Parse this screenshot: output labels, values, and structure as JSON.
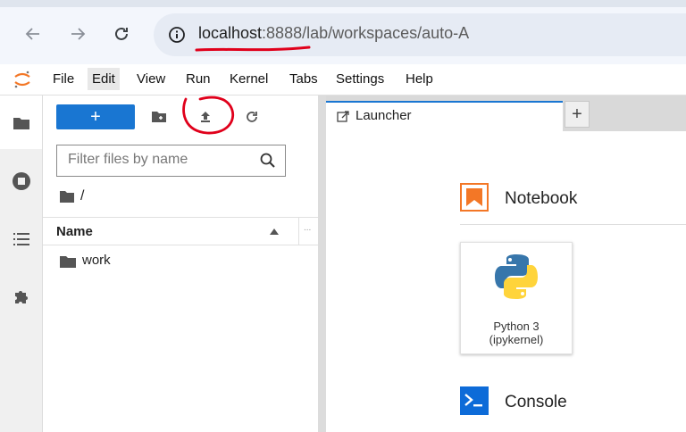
{
  "browser": {
    "url_host": "localhost",
    "url_rest": ":8888/lab/workspaces/auto-A"
  },
  "menubar": {
    "items": [
      "File",
      "Edit",
      "View",
      "Run",
      "Kernel",
      "Tabs",
      "Settings",
      "Help"
    ],
    "active_item": "Edit"
  },
  "filebrowser": {
    "new_label": "+",
    "filter_placeholder": "Filter files by name",
    "breadcrumb": "/",
    "column_name": "Name",
    "column_more": "...",
    "items": [
      {
        "name": "work",
        "type": "folder"
      }
    ]
  },
  "tabs": {
    "items": [
      {
        "label": "Launcher"
      }
    ],
    "add_label": "+"
  },
  "launcher": {
    "notebook_title": "Notebook",
    "kernel_name": "Python 3",
    "kernel_detail": "(ipykernel)",
    "console_title": "Console"
  },
  "colors": {
    "accent": "#1976d2",
    "annotation": "#e0001b",
    "notebook_icon": "#f37726",
    "console_icon": "#0d6bd8"
  },
  "icons": {
    "back": "arrow-left-icon",
    "forward": "arrow-right-icon",
    "reload": "reload-icon",
    "info": "info-icon",
    "new_folder": "new-folder-icon",
    "upload": "upload-icon",
    "refresh": "refresh-icon",
    "search": "search-icon"
  }
}
